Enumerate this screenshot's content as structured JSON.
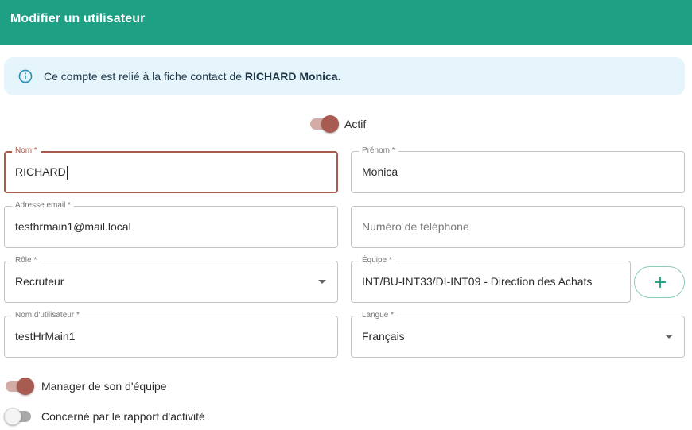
{
  "header": {
    "title": "Modifier un utilisateur"
  },
  "info": {
    "icon": "info-icon",
    "text_prefix": "Ce compte est relié à la fiche contact de ",
    "contact_name": "RICHARD Monica",
    "text_suffix": "."
  },
  "active_toggle": {
    "label": "Actif",
    "checked": true
  },
  "form": {
    "nom": {
      "label": "Nom *",
      "value": "RICHARD"
    },
    "prenom": {
      "label": "Prénom *",
      "value": "Monica"
    },
    "email": {
      "label": "Adresse email *",
      "value": "testhrmain1@mail.local"
    },
    "telephone": {
      "placeholder": "Numéro de téléphone",
      "value": ""
    },
    "role": {
      "label": "Rôle *",
      "value": "Recruteur"
    },
    "equipe": {
      "label": "Équipe *",
      "value": "INT/BU-INT33/DI-INT09 - Direction des Achats"
    },
    "username": {
      "label": "Nom d'utilisateur *",
      "value": "testHrMain1"
    },
    "langue": {
      "label": "Langue *",
      "value": "Français"
    }
  },
  "add_team_button": {
    "icon": "plus-icon"
  },
  "toggles": {
    "manager": {
      "label": "Manager de son d'équipe",
      "checked": true
    },
    "rapport": {
      "label": "Concerné par le rapport d'activité",
      "checked": false
    }
  },
  "colors": {
    "header": "#1fa085",
    "accent": "#a85b50",
    "info_bg": "#e6f5fb",
    "info_icon": "#2a8fb5"
  }
}
